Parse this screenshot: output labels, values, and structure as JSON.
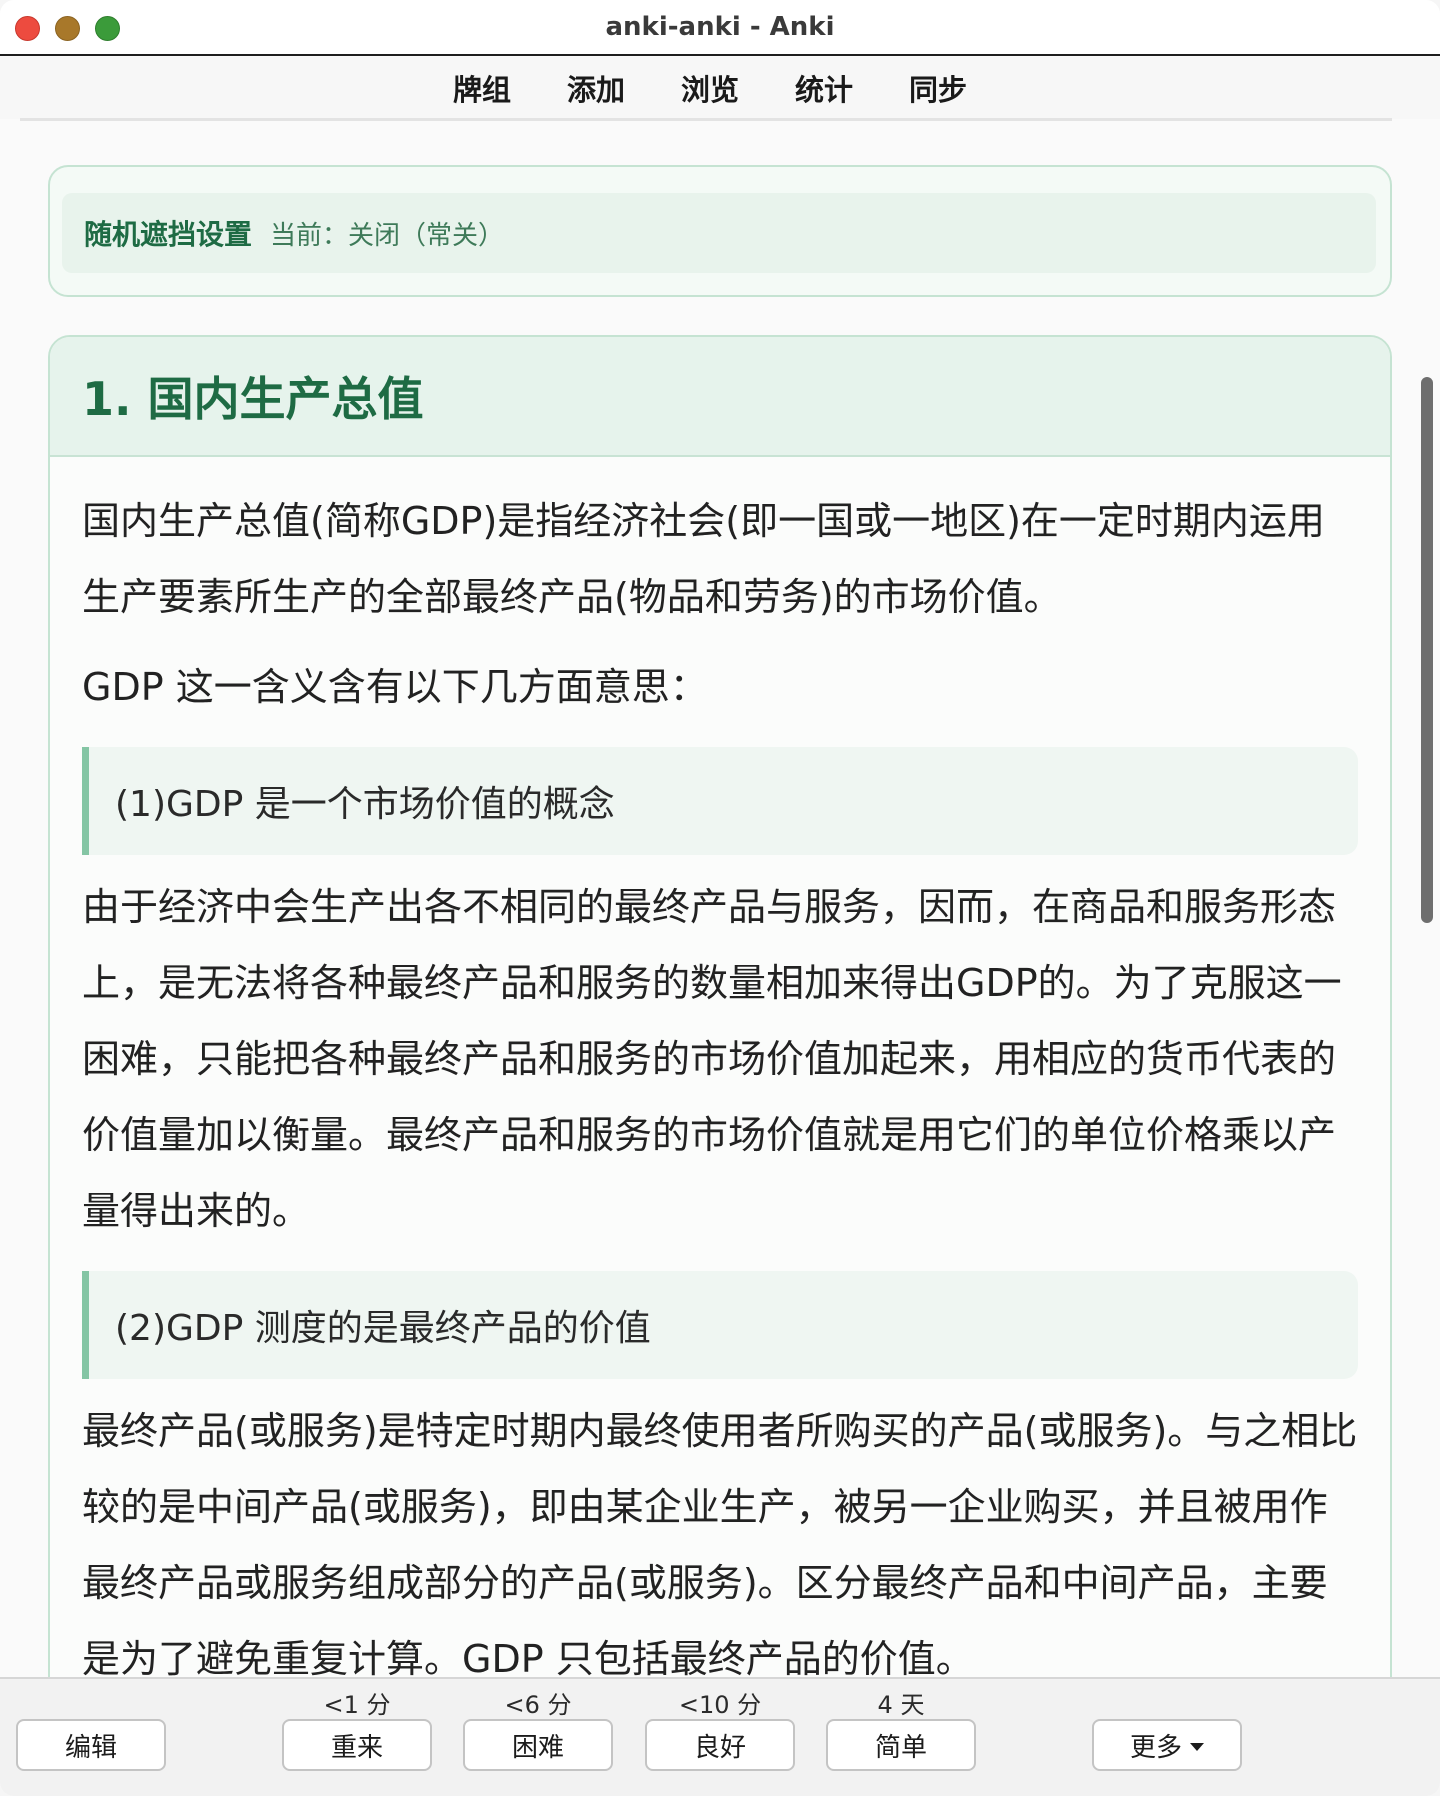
{
  "window": {
    "title": "anki-anki - Anki"
  },
  "toolbar": {
    "items": [
      "牌组",
      "添加",
      "浏览",
      "统计",
      "同步"
    ]
  },
  "settings": {
    "title": "随机遮挡设置",
    "status": "当前：关闭（常关）"
  },
  "note": {
    "title": "1. 国内生产总值",
    "p1": "国内生产总值(简称GDP)是指经济社会(即一国或一地区)在一定时期内运用生产要素所生产的全部最终产品(物品和劳务)的市场价值。",
    "p2": "GDP 这一含义含有以下几方面意思：",
    "quote1": "(1)GDP 是一个市场价值的概念",
    "p3": "由于经济中会生产出各不相同的最终产品与服务，因而，在商品和服务形态上，是无法将各种最终产品和服务的数量相加来得出GDP的。为了克服这一困难，只能把各种最终产品和服务的市场价值加起来，用相应的货币代表的价值量加以衡量。最终产品和服务的市场价值就是用它们的单位价格乘以产量得出来的。",
    "quote2": "(2)GDP 测度的是最终产品的价值",
    "p4": "最终产品(或服务)是特定时期内最终使用者所购买的产品(或服务)。与之相比较的是中间产品(或服务)，即由某企业生产，被另一企业购买，并且被用作最终产品或服务组成部分的产品(或服务)。区分最终产品和中间产品，主要是为了避免重复计算。GDP 只包括最终产品的价值。"
  },
  "answer_bar": {
    "edit": "编辑",
    "again": {
      "label": "重来",
      "interval": "<1 分"
    },
    "hard": {
      "label": "困难",
      "interval": "<6 分"
    },
    "good": {
      "label": "良好",
      "interval": "<10 分"
    },
    "easy": {
      "label": "简单",
      "interval": "4 天"
    },
    "more": "更多"
  },
  "colors": {
    "accent_green": "#1e6b44",
    "card_border": "#c5e3d2",
    "quote_bar": "#84c5a4"
  }
}
